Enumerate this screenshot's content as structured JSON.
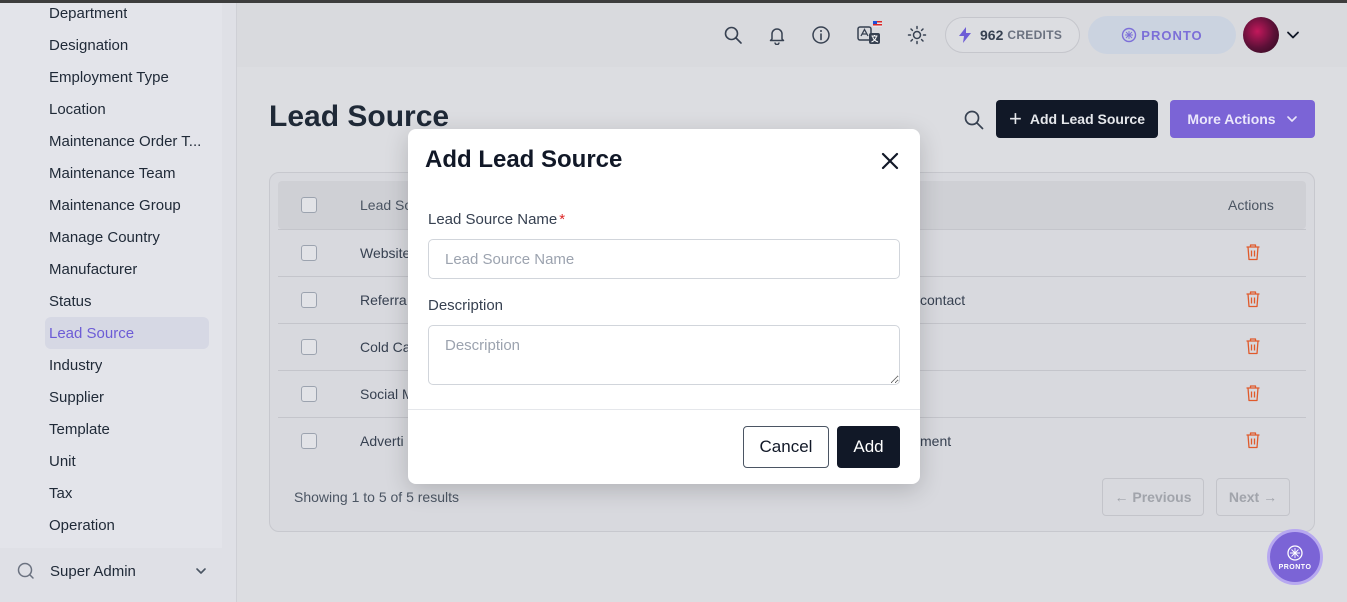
{
  "sidebar": {
    "items": [
      {
        "label": "Department"
      },
      {
        "label": "Designation"
      },
      {
        "label": "Employment Type"
      },
      {
        "label": "Location"
      },
      {
        "label": "Maintenance Order T..."
      },
      {
        "label": "Maintenance Team"
      },
      {
        "label": "Maintenance Group"
      },
      {
        "label": "Manage Country"
      },
      {
        "label": "Manufacturer"
      },
      {
        "label": "Status"
      },
      {
        "label": "Lead Source"
      },
      {
        "label": "Industry"
      },
      {
        "label": "Supplier"
      },
      {
        "label": "Template"
      },
      {
        "label": "Unit"
      },
      {
        "label": "Tax"
      },
      {
        "label": "Operation"
      }
    ],
    "active_item": "Lead Source",
    "super_admin": "Super Admin"
  },
  "header": {
    "credits_count": "962",
    "credits_label": "CREDITS",
    "brand": "PRONTO",
    "icons": [
      "search-icon",
      "bell-icon",
      "info-icon",
      "translate-icon",
      "sun-icon"
    ]
  },
  "page": {
    "title": "Lead Source",
    "add_button": "Add Lead Source",
    "more_actions": "More Actions"
  },
  "table": {
    "headers": {
      "name": "Lead So",
      "actions": "Actions"
    },
    "rows": [
      {
        "name": "Website",
        "description": ""
      },
      {
        "name": "Referra",
        "description": "contact"
      },
      {
        "name": "Cold Ca",
        "description": ""
      },
      {
        "name": "Social M",
        "description": ""
      },
      {
        "name": "Adverti",
        "description": "ment"
      }
    ],
    "showing": "Showing 1 to 5 of 5 results",
    "previous": "← Previous",
    "next": "Next →"
  },
  "modal": {
    "title": "Add Lead Source",
    "name_label": "Lead Source Name",
    "name_required": "*",
    "name_placeholder": "Lead Source Name",
    "name_value": "",
    "description_label": "Description",
    "description_placeholder": "Description",
    "description_value": "",
    "cancel": "Cancel",
    "add": "Add"
  },
  "fab": {
    "label": "PRONTO"
  },
  "colors": {
    "accent": "#7b64d6",
    "dark_button": "#111827",
    "danger": "#e05a2b"
  }
}
